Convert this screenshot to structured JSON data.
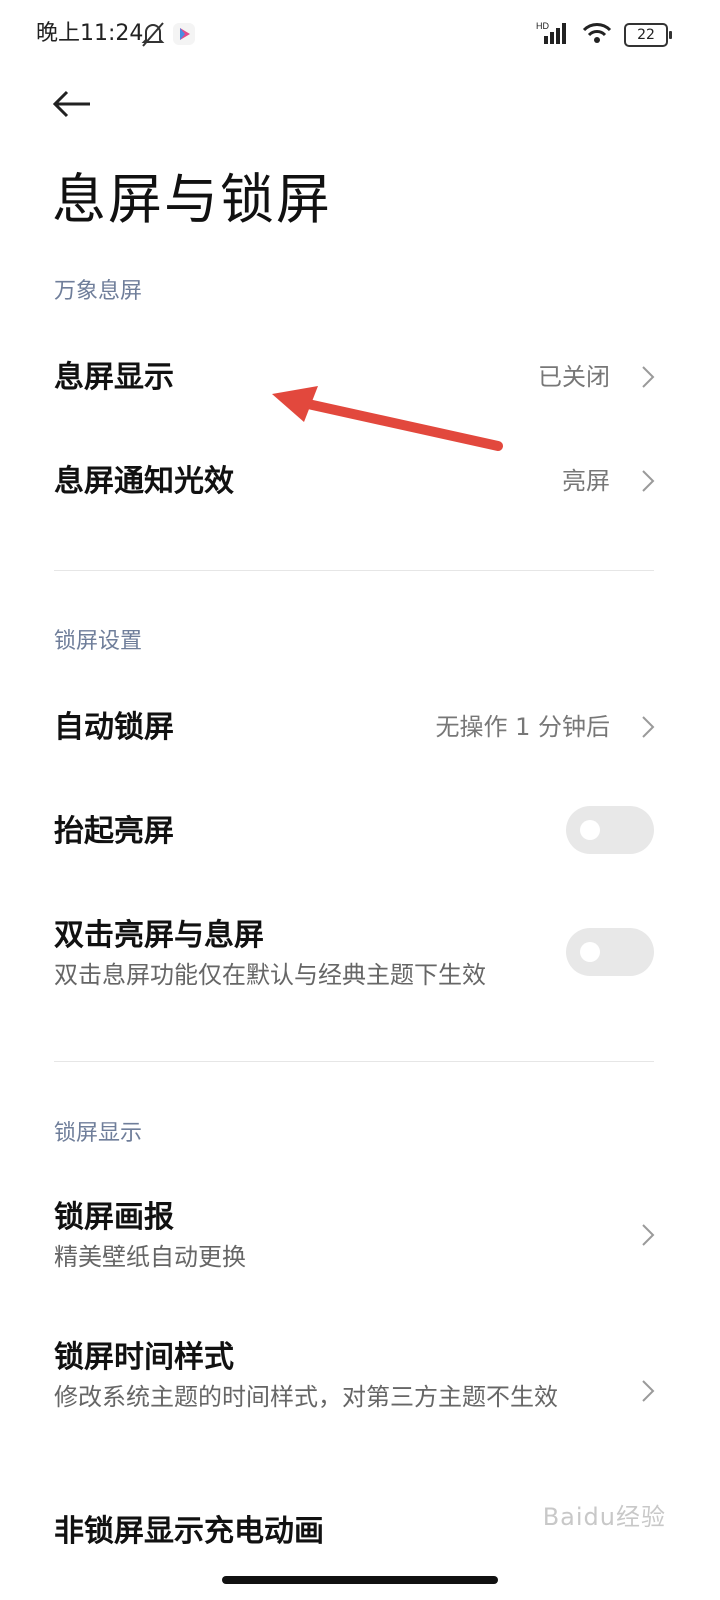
{
  "status_bar": {
    "time": "晚上11:24",
    "battery": "22"
  },
  "header": {
    "title": "息屏与锁屏"
  },
  "sections": [
    {
      "header": "万象息屏",
      "items": [
        {
          "title": "息屏显示",
          "value": "已关闭",
          "type": "nav"
        },
        {
          "title": "息屏通知光效",
          "value": "亮屏",
          "type": "nav"
        }
      ]
    },
    {
      "header": "锁屏设置",
      "items": [
        {
          "title": "自动锁屏",
          "value": "无操作 1 分钟后",
          "type": "nav"
        },
        {
          "title": "抬起亮屏",
          "type": "toggle",
          "on": false
        },
        {
          "title": "双击亮屏与息屏",
          "subtitle": "双击息屏功能仅在默认与经典主题下生效",
          "type": "toggle",
          "on": false
        }
      ]
    },
    {
      "header": "锁屏显示",
      "items": [
        {
          "title": "锁屏画报",
          "subtitle": "精美壁纸自动更换",
          "type": "nav"
        },
        {
          "title": "锁屏时间样式",
          "subtitle": "修改系统主题的时间样式，对第三方主题不生效",
          "type": "nav"
        },
        {
          "title": "非锁屏显示充电动画",
          "type": "nav"
        }
      ]
    }
  ],
  "watermark": "Baidu经验",
  "colors": {
    "accent_arrow": "#e2483d",
    "section_header": "#6f7e9a",
    "toggle_off": "#e8e8e8"
  }
}
